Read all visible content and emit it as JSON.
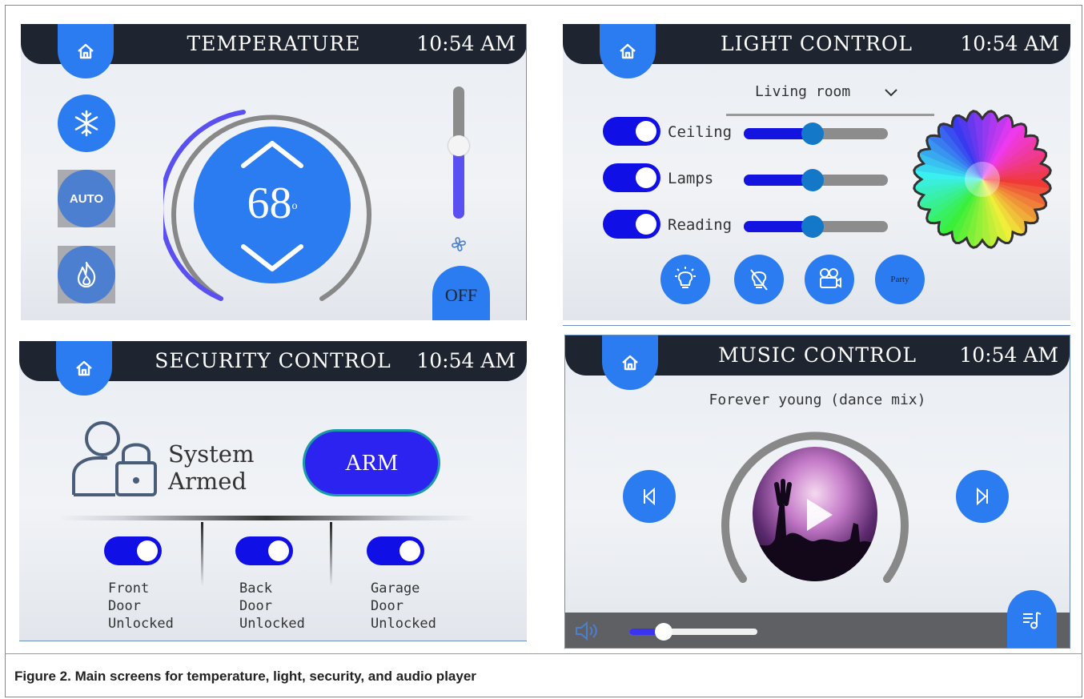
{
  "colors": {
    "accent": "#2b7cf0",
    "header": "#1f2530",
    "toggle_on": "#0f0fe6",
    "arm": "#2d23f0",
    "slider_knob": "#1478c8"
  },
  "temperature": {
    "title": "TEMPERATURE",
    "time": "10:54 AM",
    "setpoint": "68",
    "degree": "o",
    "mode_icons": [
      "snowflake-icon",
      "auto-icon",
      "flame-icon"
    ],
    "auto_label": "AUTO",
    "fan_level": 0.55,
    "fan_button": "OFF"
  },
  "light": {
    "title": "LIGHT CONTROL",
    "time": "10:54 AM",
    "room": "Living room",
    "rows": [
      {
        "label": "Ceiling",
        "level": 0.48
      },
      {
        "label": "Lamps",
        "level": 0.48
      },
      {
        "label": "Reading",
        "level": 0.48
      }
    ],
    "scenes": [
      "bulb-on-icon",
      "bulb-off-icon",
      "movie-camera-icon"
    ],
    "party_label": "Party"
  },
  "security": {
    "title": "SECURITY CONTROL",
    "time": "10:54 AM",
    "status_line1": "System",
    "status_line2": "Armed",
    "arm_label": "ARM",
    "doors": [
      {
        "l1": "Front",
        "l2": "Door",
        "l3": "Unlocked"
      },
      {
        "l1": "Back",
        "l2": "Door",
        "l3": "Unlocked"
      },
      {
        "l1": "Garage",
        "l2": "Door",
        "l3": "Unlocked"
      }
    ]
  },
  "music": {
    "title": "MUSIC CONTROL",
    "time": "10:54 AM",
    "song": "Forever young (dance mix)",
    "volume": 0.27
  },
  "caption": "Figure 2.  Main screens for temperature, light, security, and audio player"
}
